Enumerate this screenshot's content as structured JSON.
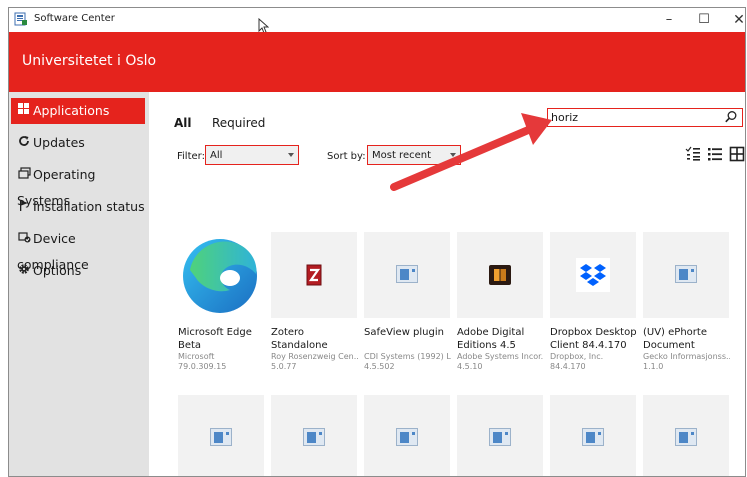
{
  "window": {
    "title": "Software Center",
    "controls": {
      "minimize": "–",
      "maximize": "☐",
      "close": "✕"
    }
  },
  "header": {
    "org_name": "Universitetet i Oslo"
  },
  "sidebar": {
    "items": [
      {
        "label": "Applications",
        "icon": "applications-icon",
        "active": true
      },
      {
        "label": "Updates",
        "icon": "refresh-icon",
        "active": false
      },
      {
        "label": "Operating Systems",
        "icon": "operating-systems-icon",
        "active": false
      },
      {
        "label": "Installation status",
        "icon": "flag-icon",
        "active": false
      },
      {
        "label": "Device compliance",
        "icon": "device-compliance-icon",
        "active": false
      },
      {
        "label": "Options",
        "icon": "gear-icon",
        "active": false
      }
    ]
  },
  "main": {
    "tabs": [
      {
        "label": "All",
        "active": true
      },
      {
        "label": "Required",
        "active": false
      }
    ],
    "search": {
      "value": "horiz"
    },
    "filter": {
      "label": "Filter:",
      "value": "All"
    },
    "sort": {
      "label": "Sort by:",
      "value": "Most recent"
    },
    "view_modes": [
      "list-compact-icon",
      "list-icon",
      "grid-icon"
    ],
    "apps": [
      {
        "name": "Microsoft Edge Beta",
        "publisher": "Microsoft",
        "version": "79.0.309.15",
        "icon": "edge-logo"
      },
      {
        "name": "Zotero Standalone",
        "publisher": "Roy Rosenzweig Cen...",
        "version": "5.0.77",
        "icon": "zotero-logo"
      },
      {
        "name": "SafeView plugin",
        "publisher": "CDI Systems (1992) L...",
        "version": "4.5.502",
        "icon": "generic-app-icon"
      },
      {
        "name": "Adobe Digital Editions 4.5",
        "publisher": "Adobe Systems Incor...",
        "version": "4.5.10",
        "icon": "adobe-digital-editions-logo"
      },
      {
        "name": "Dropbox Desktop Client 84.4.170",
        "publisher": "Dropbox, Inc.",
        "version": "84.4.170",
        "icon": "dropbox-logo"
      },
      {
        "name": "(UV) ePhorte Document Uploa...",
        "publisher": "Gecko Informasjonss...",
        "version": "1.1.0",
        "icon": "generic-app-icon"
      },
      {
        "name": "",
        "publisher": "",
        "version": "",
        "icon": "generic-app-icon"
      },
      {
        "name": "",
        "publisher": "",
        "version": "",
        "icon": "generic-app-icon"
      },
      {
        "name": "",
        "publisher": "",
        "version": "",
        "icon": "generic-app-icon"
      },
      {
        "name": "",
        "publisher": "",
        "version": "",
        "icon": "generic-app-icon"
      },
      {
        "name": "",
        "publisher": "",
        "version": "",
        "icon": "generic-app-icon"
      },
      {
        "name": "",
        "publisher": "",
        "version": "",
        "icon": "generic-app-icon"
      }
    ]
  },
  "colors": {
    "accent": "#e5231d",
    "sidebar_bg": "#e2e2e2",
    "tile_bg": "#f2f2f2",
    "arrow": "#e5393a"
  }
}
